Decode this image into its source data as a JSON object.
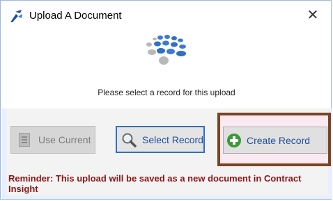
{
  "window": {
    "title": "Upload A Document",
    "close_symbol": "✕"
  },
  "icons": {
    "app": "app-logo-icon",
    "close": "close-icon",
    "use_current": "document-icon",
    "select_record": "magnifier-icon",
    "create_record": "plus-circle-icon"
  },
  "main": {
    "prompt": "Please select a record for this upload"
  },
  "buttons": {
    "use_current": "Use Current",
    "select_record": "Select Record",
    "create_record": "Create Record"
  },
  "reminder": "Reminder:  This upload will be saved as a new document in Contract Insight",
  "colors": {
    "accent_blue": "#2f6fc4",
    "reminder_red": "#8b1515",
    "highlight_frame": "#7a4424",
    "create_green": "#3a9a3a"
  }
}
